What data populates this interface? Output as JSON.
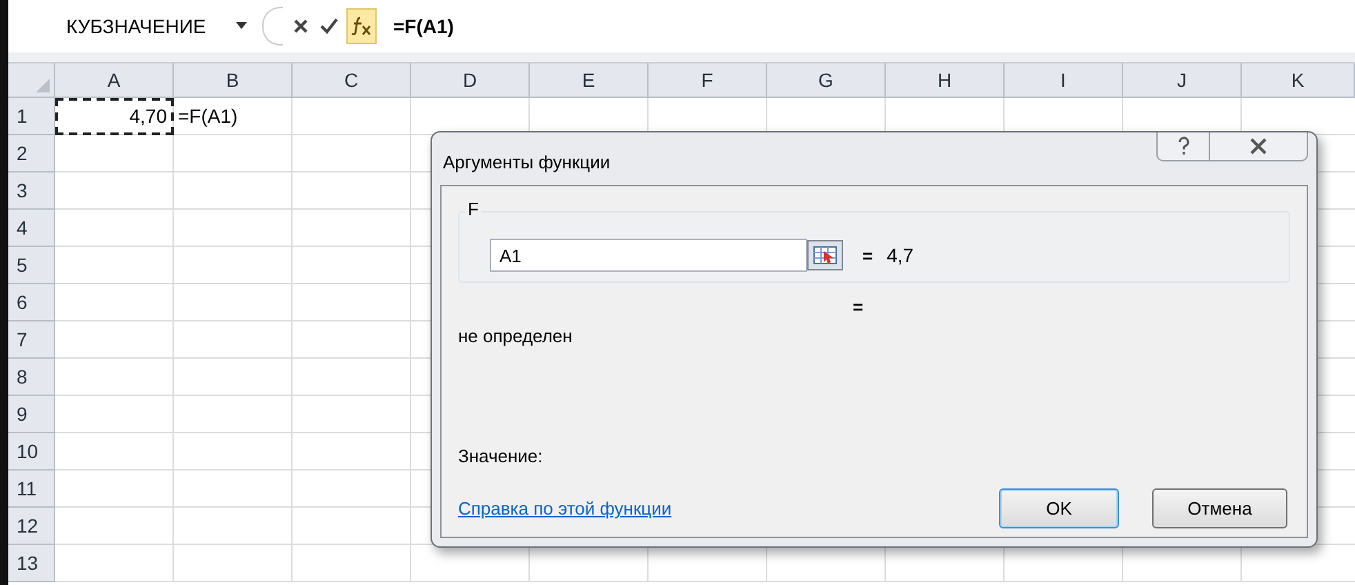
{
  "formula_bar": {
    "name_box": "КУБЗНАЧЕНИЕ",
    "formula": "=F(A1)"
  },
  "sheet": {
    "columns": [
      "A",
      "B",
      "C",
      "D",
      "E",
      "F",
      "G",
      "H",
      "I",
      "J",
      "K"
    ],
    "rows": [
      {
        "label": "1",
        "cells": [
          {
            "text": "4,70",
            "kind": "number",
            "copy_marquee": true
          },
          {
            "text": "=F(A1)",
            "kind": "text",
            "copy_marquee": false
          }
        ]
      },
      {
        "label": "2"
      },
      {
        "label": "3"
      },
      {
        "label": "4"
      },
      {
        "label": "5"
      },
      {
        "label": "6"
      },
      {
        "label": "7"
      },
      {
        "label": "8"
      },
      {
        "label": "9"
      },
      {
        "label": "10"
      },
      {
        "label": "11"
      },
      {
        "label": "12"
      },
      {
        "label": "13"
      }
    ]
  },
  "dialog": {
    "title": "Аргументы функции",
    "argument": {
      "label": "F",
      "value": "A1",
      "equals": "=",
      "result": "4,7"
    },
    "function_equals": "=",
    "description": "не определен",
    "value_label": "Значение:",
    "help_link": "Справка по этой функции",
    "buttons": [
      {
        "label": "OK",
        "default": true
      },
      {
        "label": "Отмена",
        "default": false
      }
    ]
  }
}
